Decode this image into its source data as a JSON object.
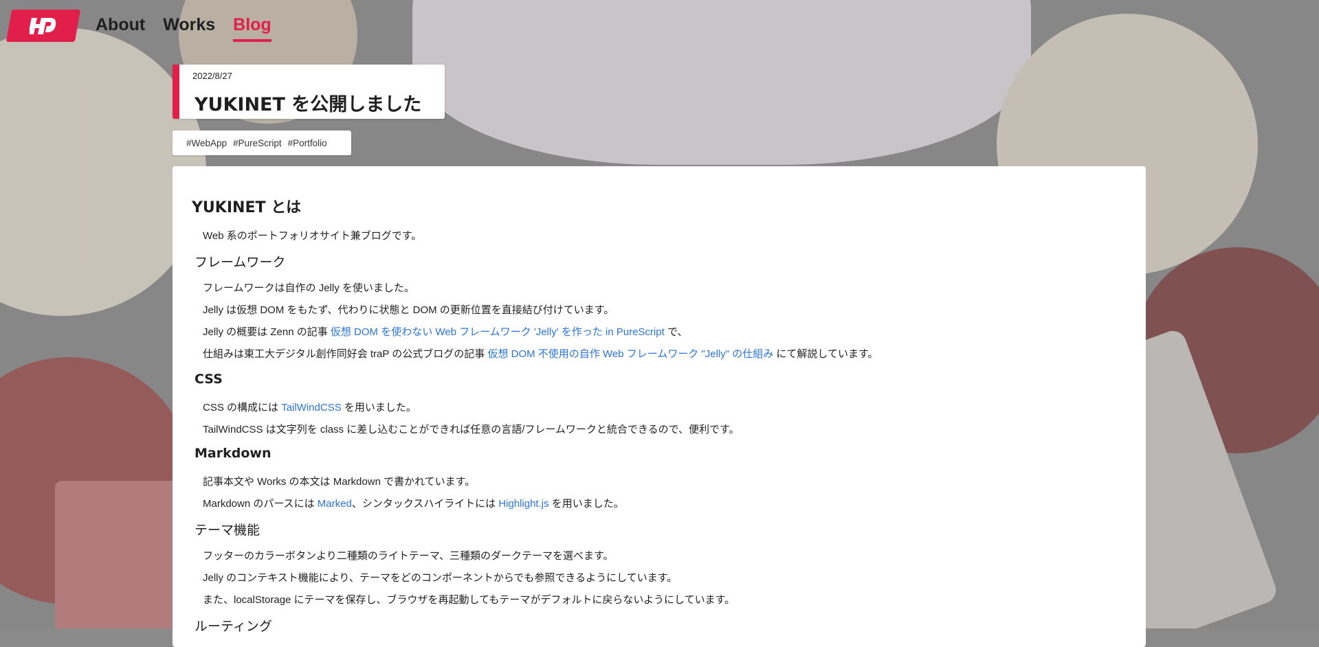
{
  "nav": {
    "logo_text": "YD",
    "items": [
      {
        "label": "About",
        "active": false
      },
      {
        "label": "Works",
        "active": false
      },
      {
        "label": "Blog",
        "active": true
      }
    ]
  },
  "post": {
    "date": "2022/8/27",
    "title": "YUKINET を公開しました",
    "tags": [
      "#WebApp",
      "#PureScript",
      "#Portfolio"
    ]
  },
  "article": {
    "h_intro": "YUKINET とは",
    "p_intro": "Web 系のポートフォリオサイト兼ブログです。",
    "h_framework": "フレームワーク",
    "p_fw1": "フレームワークは自作の Jelly を使いました。",
    "p_fw2": "Jelly は仮想 DOM をもたず、代わりに状態と DOM の更新位置を直接結び付けています。",
    "p_fw3_pre": "Jelly の概要は Zenn の記事 ",
    "p_fw3_link": "仮想 DOM を使わない Web フレームワーク 'Jelly' を作った in PureScript",
    "p_fw3_post": " で、",
    "p_fw4_pre": "仕組みは東工大デジタル創作同好会 traP の公式ブログの記事 ",
    "p_fw4_link": "仮想 DOM 不使用の自作 Web フレームワーク \"Jelly\" の仕組み",
    "p_fw4_post": " にて解説しています。",
    "h_css": "CSS",
    "p_css1_pre": "CSS の構成には ",
    "p_css1_link": "TailWindCSS",
    "p_css1_post": " を用いました。",
    "p_css2": "TailWindCSS は文字列を class に差し込むことができれば任意の言語/フレームワークと統合できるので、便利です。",
    "h_md": "Markdown",
    "p_md1": "記事本文や Works の本文は Markdown で書かれています。",
    "p_md2_pre": "Markdown のパースには ",
    "p_md2_link1": "Marked",
    "p_md2_mid": "、シンタックスハイライトには ",
    "p_md2_link2": "Highlight.js",
    "p_md2_post": " を用いました。",
    "h_theme": "テーマ機能",
    "p_th1": "フッターのカラーボタンより二種類のライトテーマ、三種類のダークテーマを選べます。",
    "p_th2": "Jelly のコンテキスト機能により、テーマをどのコンポーネントからでも参照できるようにしています。",
    "p_th3": "また、localStorage にテーマを保存し、ブラウザを再起動してもテーマがデフォルトに戻らないようにしています。",
    "h_routing": "ルーティング"
  },
  "colors": {
    "accent": "#e21e4b",
    "link": "#2a74e0"
  }
}
